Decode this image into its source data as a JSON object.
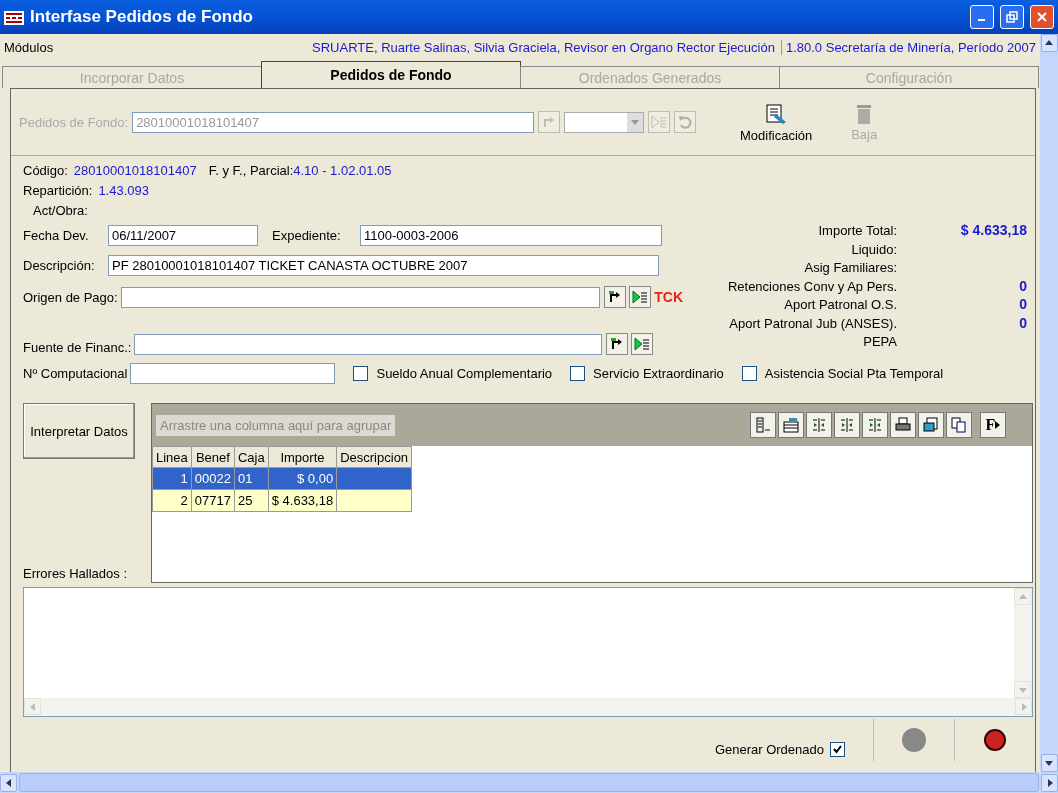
{
  "window": {
    "title": "Interfase Pedidos de Fondo"
  },
  "menu": {
    "label": "Módulos",
    "user": "SRUARTE, Ruarte Salinas, Silvia Graciela, Revisor en Organo Rector Ejecución",
    "version": "1.80.0 Secretaría de Minería, Período 2007"
  },
  "tabs": [
    {
      "label": "Incorporar Datos",
      "selected": false,
      "disabled": true
    },
    {
      "label": "Pedidos de Fondo",
      "selected": true,
      "disabled": false
    },
    {
      "label": "Ordenados Generados",
      "selected": false,
      "disabled": true
    },
    {
      "label": "Configuración",
      "selected": false,
      "disabled": true
    }
  ],
  "record_bar": {
    "label": "Pedidos de Fondo:",
    "value": "28010001018101407",
    "disabled": true,
    "actions": [
      {
        "kind": "modify",
        "label": "Modificación",
        "disabled": false
      },
      {
        "kind": "delete",
        "label": "Baja",
        "disabled": true
      }
    ]
  },
  "info": {
    "codigo_label": "Código:",
    "codigo": "28010001018101407",
    "ff_label": "F. y F., Parcial:",
    "ff": "4.10 - 1.02.01.05",
    "reparticion_label": "Repartición:",
    "reparticion": "1.43.093",
    "act_obra_label": "Act/Obra:"
  },
  "fecha_dev": {
    "label": "Fecha Dev.",
    "value": "06/11/2007"
  },
  "expediente": {
    "label": "Expediente:",
    "value": "1100-0003-2006"
  },
  "descripcion": {
    "label": "Descripción:",
    "value": "PF 28010001018101407 TICKET CANASTA OCTUBRE 2007"
  },
  "origen_pago": {
    "label": "Origen de Pago:",
    "tag": "TCK"
  },
  "fuente_financ": {
    "label": "Fuente de Financ.:"
  },
  "nro_computacional": {
    "label": "Nº Computacional"
  },
  "options": [
    {
      "label": "Sueldo Anual Complementario",
      "checked": false
    },
    {
      "label": "Servicio Extraordinario",
      "checked": false
    },
    {
      "label": "Asistencia Social Pta Temporal",
      "checked": false
    }
  ],
  "totals": [
    {
      "label": "Importe Total:",
      "value": "$ 4.633,18"
    },
    {
      "label": "Liquido:"
    },
    {
      "label": "Asig Familiares:"
    },
    {
      "label": "Retenciones Conv y Ap Pers.",
      "value": "0"
    },
    {
      "label": "Aport Patronal O.S.",
      "value": "0"
    },
    {
      "label": "Aport Patronal Jub (ANSES).",
      "value": "0"
    },
    {
      "label": "PEPA"
    }
  ],
  "interpret_button": "Interpretar Datos",
  "grid": {
    "group_hint": "Arrastre una columna aquí para agrupar",
    "toolbar": [
      {
        "kind": "columns"
      },
      {
        "kind": "edit"
      },
      {
        "kind": "split"
      },
      {
        "kind": "split"
      },
      {
        "kind": "split"
      },
      {
        "kind": "print"
      },
      {
        "kind": "preview"
      },
      {
        "kind": "copy"
      },
      {
        "kind": "font",
        "text": "F"
      }
    ],
    "columns": [
      "Linea",
      "Benef",
      "Caja",
      "Importe",
      "Descripcion"
    ],
    "rows": [
      {
        "cells": [
          "1",
          "00022",
          "01",
          "$ 0,00",
          ""
        ],
        "selected": true
      },
      {
        "cells": [
          "2",
          "07717",
          "25",
          "$ 4.633,18",
          ""
        ],
        "selected": false
      }
    ]
  },
  "errors_label": "Errores Hallados :",
  "footer": {
    "generar_label": "Generar Ordenado",
    "generar_checked": true
  }
}
